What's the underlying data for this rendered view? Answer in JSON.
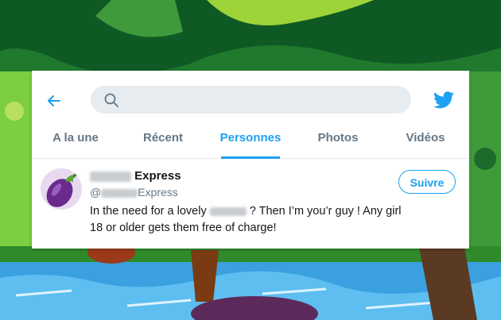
{
  "search": {
    "placeholder": "",
    "value": ""
  },
  "tabs": [
    {
      "label": "A la une",
      "active": false
    },
    {
      "label": "Récent",
      "active": false
    },
    {
      "label": "Personnes",
      "active": true
    },
    {
      "label": "Photos",
      "active": false
    },
    {
      "label": "Vidéos",
      "active": false
    }
  ],
  "result": {
    "name_suffix": "Express",
    "handle_prefix": "@",
    "handle_suffix": "Express",
    "tweet_part1": "In the need for a lovely",
    "tweet_part2": "? Then I’m you’r guy ! Any girl 18 or older gets them free of charge!",
    "follow_label": "Suivre",
    "avatar_icon": "eggplant-emoji"
  },
  "colors": {
    "accent": "#1da1f2",
    "text": "#14171a",
    "muted": "#657786"
  }
}
